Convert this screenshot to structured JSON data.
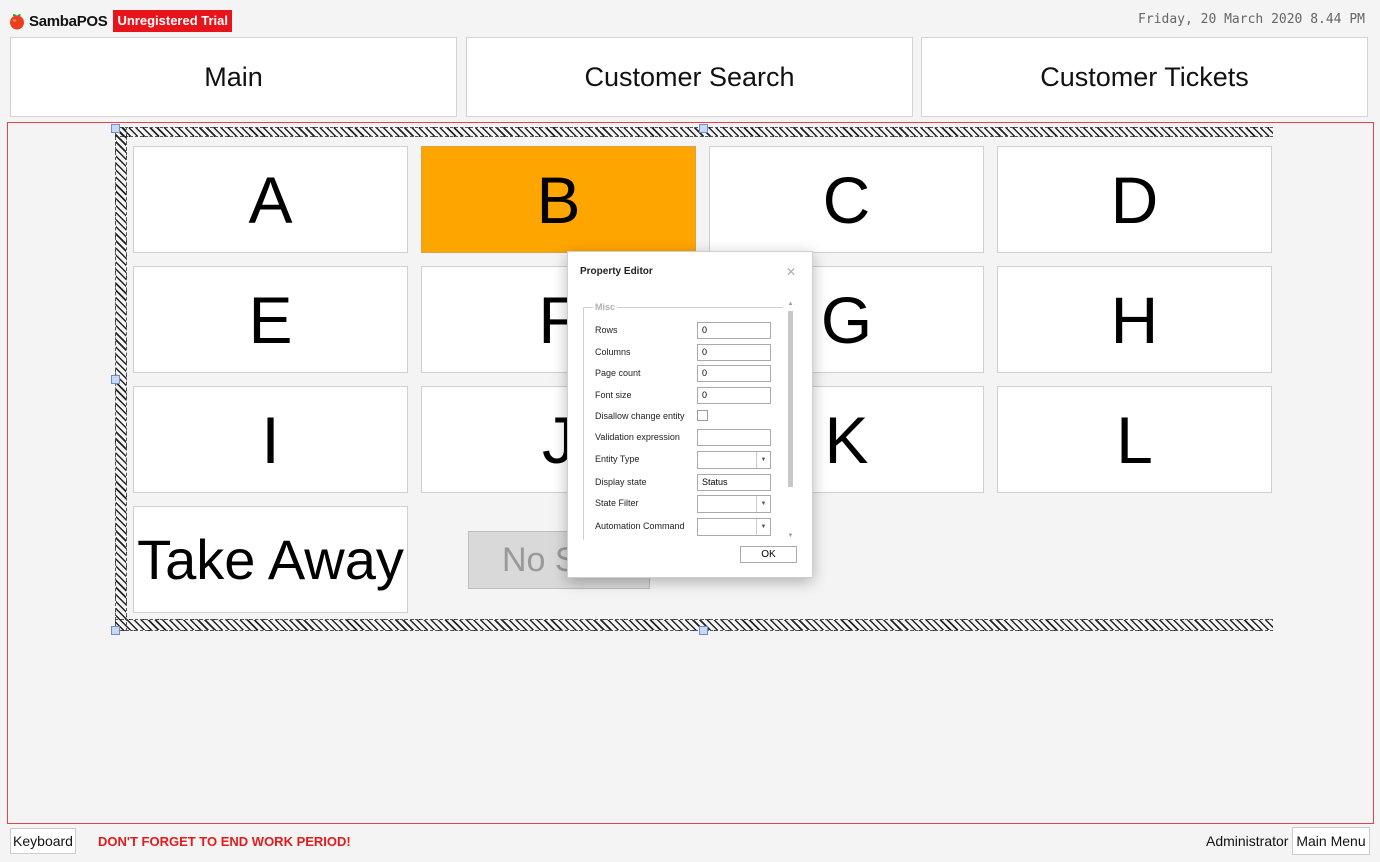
{
  "header": {
    "app_name": "SambaPOS",
    "trial_badge": "Unregistered Trial",
    "datetime": "Friday, 20 March 2020 8.44 PM",
    "logo_icon": "tomato-icon",
    "logo_color": "#e8401c",
    "badge_color": "#e8141b"
  },
  "nav": {
    "tabs": [
      {
        "label": "Main"
      },
      {
        "label": "Customer Search"
      },
      {
        "label": "Customer Tickets"
      }
    ]
  },
  "entity_grid": {
    "buttons": [
      {
        "label": "A"
      },
      {
        "label": "B",
        "selected": true
      },
      {
        "label": "C"
      },
      {
        "label": "D"
      },
      {
        "label": "E"
      },
      {
        "label": "F"
      },
      {
        "label": "G"
      },
      {
        "label": "H"
      },
      {
        "label": "I"
      },
      {
        "label": "J"
      },
      {
        "label": "K"
      },
      {
        "label": "L"
      },
      {
        "label": "Take Away"
      }
    ],
    "selected_color": "#ffa500",
    "no_selection_label": "No S"
  },
  "property_editor": {
    "title": "Property Editor",
    "close_icon": "close-icon",
    "group_label": "Misc",
    "properties": [
      {
        "label": "Rows",
        "type": "text",
        "value": "0"
      },
      {
        "label": "Columns",
        "type": "text",
        "value": "0"
      },
      {
        "label": "Page count",
        "type": "text",
        "value": "0"
      },
      {
        "label": "Font size",
        "type": "text",
        "value": "0"
      },
      {
        "label": "Disallow change entity",
        "type": "checkbox",
        "checked": false
      },
      {
        "label": "Validation expression",
        "type": "text",
        "value": ""
      },
      {
        "label": "Entity Type",
        "type": "combo",
        "value": ""
      },
      {
        "label": "Display state",
        "type": "text",
        "value": "Status"
      },
      {
        "label": "State Filter",
        "type": "combo",
        "value": ""
      },
      {
        "label": "Automation Command",
        "type": "combo",
        "value": ""
      }
    ],
    "ok_label": "OK"
  },
  "footer": {
    "keyboard_label": "Keyboard",
    "warning": "DON'T FORGET TO END WORK PERIOD!",
    "warning_color": "#e31b1b",
    "user": "Administrator",
    "main_menu_label": "Main Menu"
  }
}
